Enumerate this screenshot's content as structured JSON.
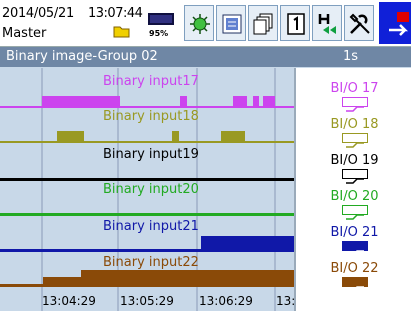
{
  "status": {
    "date": "2014/05/21",
    "time": "13:07:44",
    "user": "Master",
    "media_percent": "95%",
    "buttons": [
      "alarm-icon",
      "message-icon",
      "multi-panel-icon",
      "historical-icon",
      "settings-icon"
    ]
  },
  "title": {
    "group": "Binary image-Group 02",
    "rate": "1s"
  },
  "channels": [
    {
      "label": "Binary input17",
      "tag": "BI/O 17",
      "color": "#cc44ee",
      "icon": "binary-off-icon"
    },
    {
      "label": "Binary input18",
      "tag": "BI/O 18",
      "color": "#999922",
      "icon": "binary-off-icon"
    },
    {
      "label": "Binary input19",
      "tag": "BI/O 19",
      "color": "#000000",
      "icon": "binary-off-icon"
    },
    {
      "label": "Binary input20",
      "tag": "BI/O 20",
      "color": "#22aa22",
      "icon": "binary-off-icon"
    },
    {
      "label": "Binary input21",
      "tag": "BI/O 21",
      "color": "#1018a8",
      "icon": "binary-on-icon"
    },
    {
      "label": "Binary input22",
      "tag": "BI/O 22",
      "color": "#8a4a08",
      "icon": "binary-on-icon"
    }
  ],
  "time_axis": [
    "13:04:29",
    "13:05:29",
    "13:06:29",
    "13:"
  ]
}
